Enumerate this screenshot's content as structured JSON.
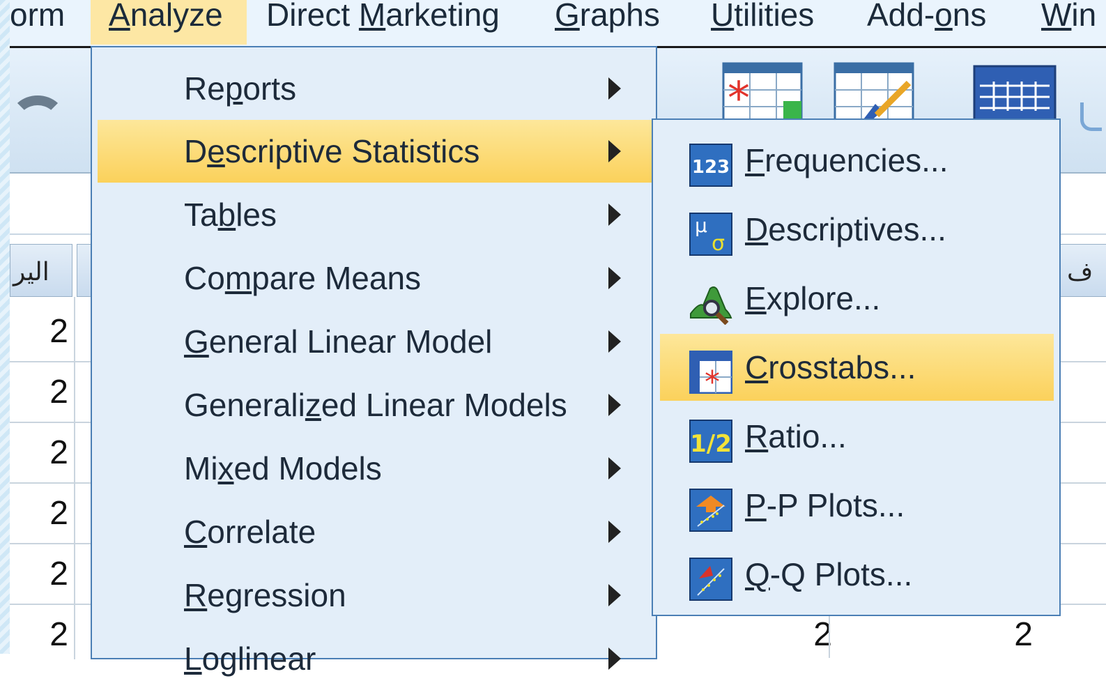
{
  "menubar": {
    "items": [
      {
        "pre": "",
        "u": "",
        "post": "orm"
      },
      {
        "pre": "",
        "u": "A",
        "post": "nalyze"
      },
      {
        "pre": "Direct ",
        "u": "M",
        "post": "arketing"
      },
      {
        "pre": "",
        "u": "G",
        "post": "raphs"
      },
      {
        "pre": "",
        "u": "U",
        "post": "tilities"
      },
      {
        "pre": "Add-",
        "u": "o",
        "post": "ns"
      },
      {
        "pre": "",
        "u": "W",
        "post": "in"
      }
    ]
  },
  "analyze_menu": {
    "items": [
      {
        "pre": "Re",
        "u": "p",
        "post": "orts"
      },
      {
        "pre": "D",
        "u": "e",
        "post": "scriptive Statistics"
      },
      {
        "pre": "Ta",
        "u": "b",
        "post": "les"
      },
      {
        "pre": "Co",
        "u": "m",
        "post": "pare Means"
      },
      {
        "pre": "",
        "u": "G",
        "post": "eneral Linear Model"
      },
      {
        "pre": "Generali",
        "u": "z",
        "post": "ed Linear Models"
      },
      {
        "pre": "Mi",
        "u": "x",
        "post": "ed Models"
      },
      {
        "pre": "",
        "u": "C",
        "post": "orrelate"
      },
      {
        "pre": "",
        "u": "R",
        "post": "egression"
      },
      {
        "pre": "",
        "u": "L",
        "post": "oglinear"
      }
    ]
  },
  "descriptive_submenu": {
    "items": [
      {
        "pre": "",
        "u": "F",
        "post": "requencies...",
        "icon": "frequencies-icon"
      },
      {
        "pre": "",
        "u": "D",
        "post": "escriptives...",
        "icon": "descriptives-icon"
      },
      {
        "pre": "",
        "u": "E",
        "post": "xplore...",
        "icon": "explore-icon"
      },
      {
        "pre": "",
        "u": "C",
        "post": "rosstabs...",
        "icon": "crosstabs-icon"
      },
      {
        "pre": "",
        "u": "R",
        "post": "atio...",
        "icon": "ratio-icon"
      },
      {
        "pre": "",
        "u": "P",
        "post": "-P Plots...",
        "icon": "pp-plots-icon"
      },
      {
        "pre": "",
        "u": "Q",
        "post": "-Q Plots...",
        "icon": "qq-plots-icon"
      }
    ]
  },
  "grid": {
    "header_left": "الير",
    "header_right": "ف",
    "cells": [
      "2",
      "2",
      "2",
      "2",
      "2",
      "2"
    ],
    "bottom_cells": [
      "2",
      "2"
    ]
  },
  "icon_text": {
    "frequencies": "123",
    "descriptives_mu": "μ",
    "descriptives_sigma": "σ",
    "ratio": "1/2"
  },
  "colors": {
    "menu_bg": "#e3eef9",
    "highlight": "#fbd15b",
    "border": "#4b7fb5",
    "active_menu": "#fde7a4"
  }
}
